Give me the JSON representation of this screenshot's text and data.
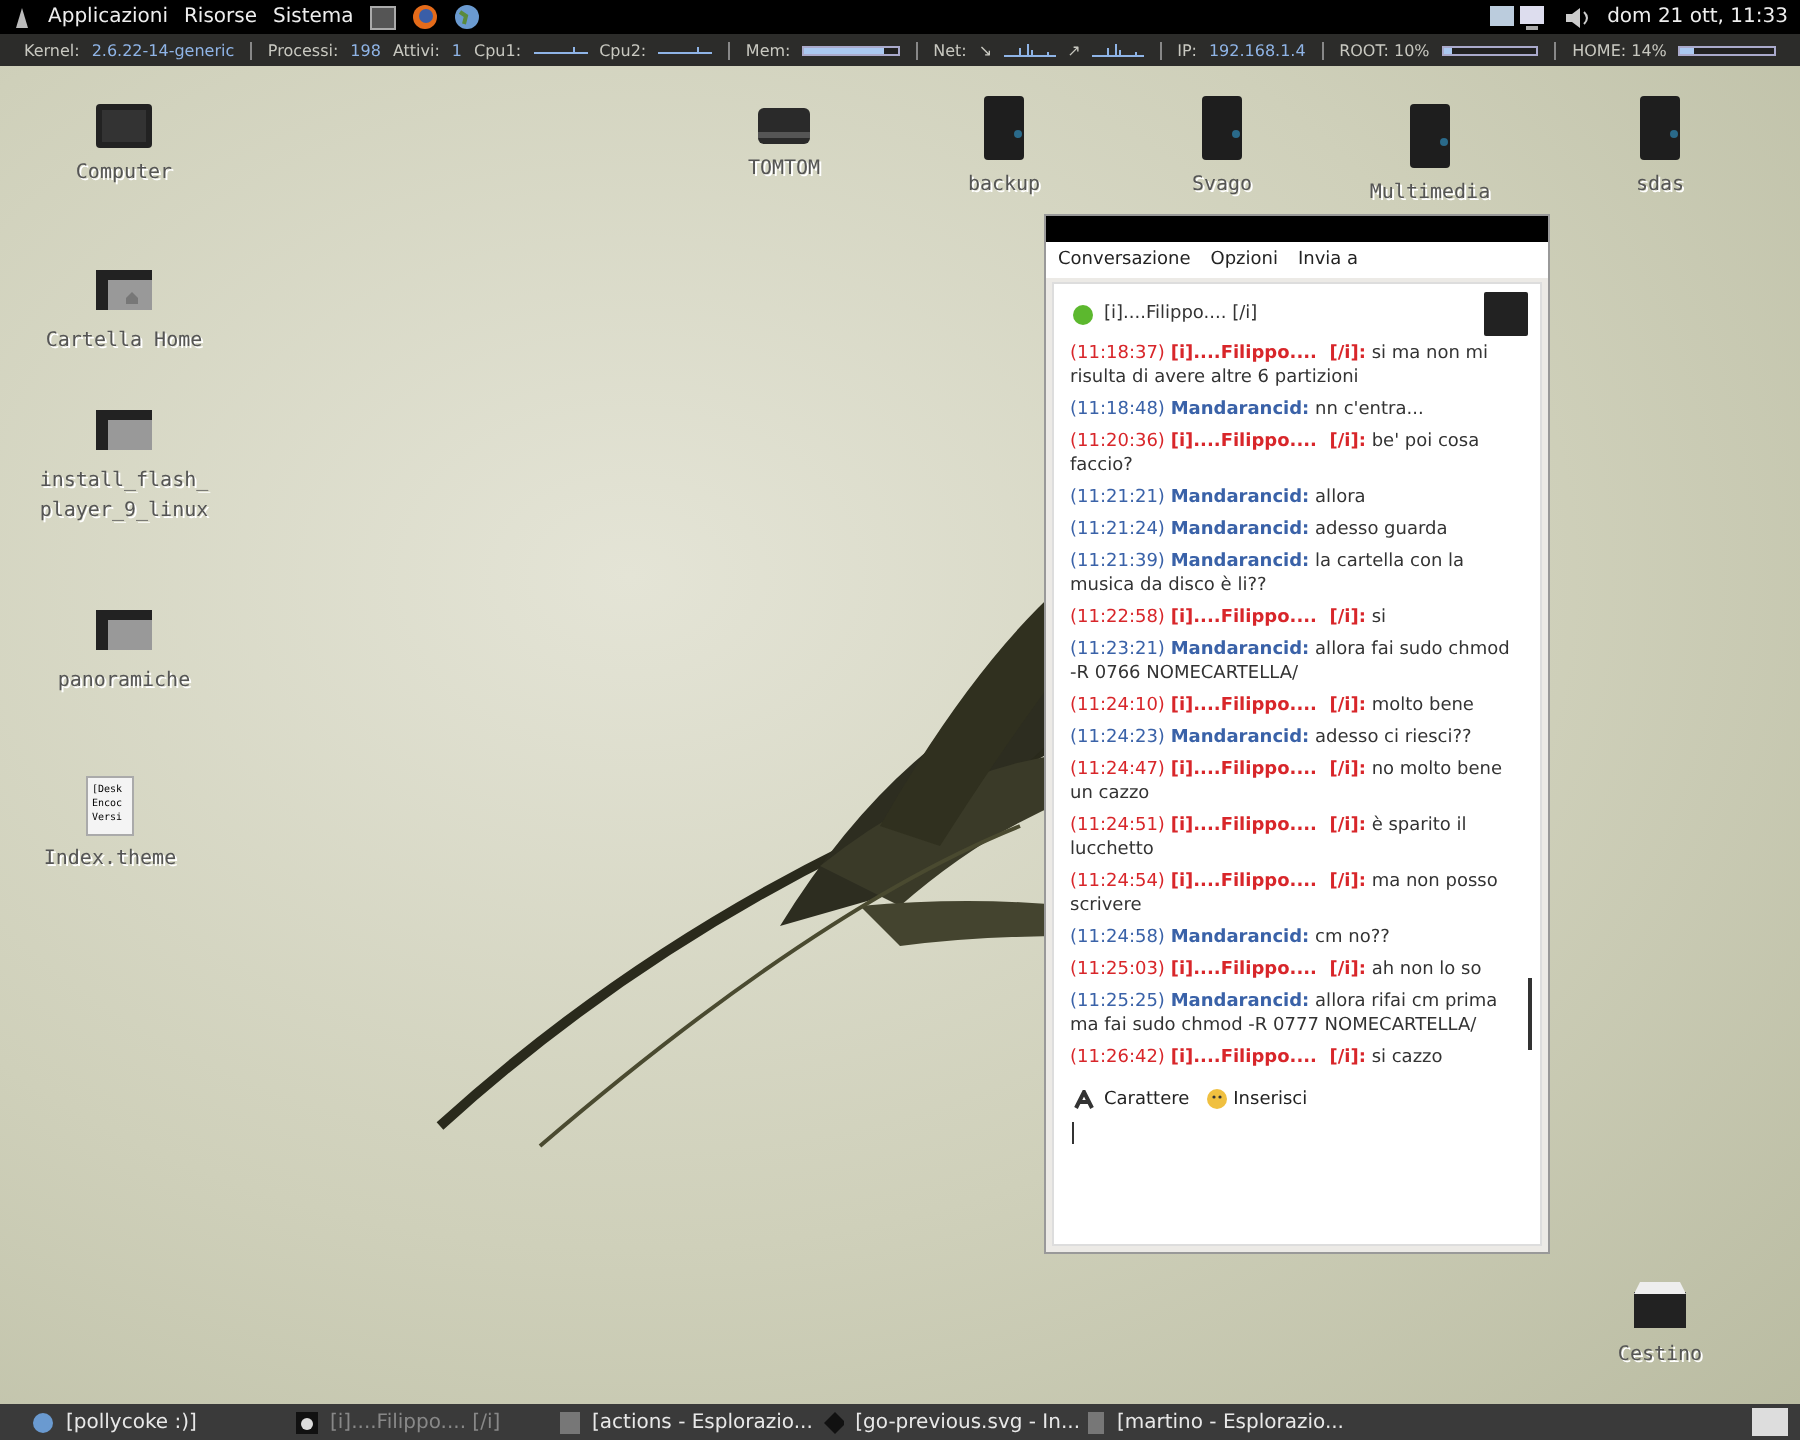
{
  "top_panel": {
    "menus": [
      "Applicazioni",
      "Risorse",
      "Sistema"
    ],
    "clock": "dom 21 ott, 11:33"
  },
  "system_monitor": [
    {
      "kind": "text",
      "label": "Kernel:",
      "value": "2.6.22-14-generic"
    },
    {
      "kind": "text",
      "label": "Processi:",
      "value": "198"
    },
    {
      "kind": "text",
      "label": "Attivi:",
      "value": "1"
    },
    {
      "kind": "graph",
      "label": "Cpu1:"
    },
    {
      "kind": "graph",
      "label": "Cpu2:"
    },
    {
      "kind": "bar",
      "label": "Mem:",
      "level": 0.85
    },
    {
      "kind": "net",
      "label": "Net:",
      "value": "↘"
    },
    {
      "kind": "net",
      "value": "↗"
    },
    {
      "kind": "text",
      "label": "IP:",
      "value": "192.168.1.4"
    },
    {
      "kind": "bar",
      "label": "ROOT: 10%",
      "level": 0.1
    },
    {
      "kind": "bar",
      "label": "HOME: 14%",
      "level": 0.14
    }
  ],
  "desktop_icons": [
    {
      "kind": "computer",
      "label": "Computer"
    },
    {
      "kind": "drive",
      "label": "TOMTOM"
    },
    {
      "kind": "disk",
      "label": "backup"
    },
    {
      "kind": "disk",
      "label": "Svago"
    },
    {
      "kind": "disk",
      "label": "Multimedia"
    },
    {
      "kind": "disk",
      "label": "sdas"
    },
    {
      "kind": "home",
      "label": "Cartella Home"
    },
    {
      "kind": "folder",
      "label": "install_flash_ player_9_linux"
    },
    {
      "kind": "folder",
      "label": "panoramiche"
    },
    {
      "kind": "file",
      "label": "Index.theme",
      "preview": [
        "[Desk",
        "Encoc",
        "Versi"
      ]
    },
    {
      "kind": "trash",
      "label": "Cestino"
    }
  ],
  "chat_window": {
    "menu": [
      "Conversazione",
      "Opzioni",
      "Invia a"
    ],
    "buddy": {
      "name": "[i]....Filippo.... [/i]",
      "online": true
    },
    "messages": [
      {
        "kind": "peer",
        "time": "(11:18:37)",
        "sender": "[i]....Filippo....  [/i]:",
        "text": "si ma non mi risulta di avere altre 6 partizioni"
      },
      {
        "kind": "self",
        "time": "(11:18:48)",
        "sender": "Mandarancid:",
        "text": "nn c'entra..."
      },
      {
        "kind": "peer",
        "time": "(11:20:36)",
        "sender": "[i]....Filippo....  [/i]:",
        "text": "be' poi cosa faccio?"
      },
      {
        "kind": "self",
        "time": "(11:21:21)",
        "sender": "Mandarancid:",
        "text": "allora"
      },
      {
        "kind": "self",
        "time": "(11:21:24)",
        "sender": "Mandarancid:",
        "text": "adesso guarda"
      },
      {
        "kind": "self",
        "time": "(11:21:39)",
        "sender": "Mandarancid:",
        "text": "la cartella con la musica da disco è li??"
      },
      {
        "kind": "peer",
        "time": "(11:22:58)",
        "sender": "[i]....Filippo....  [/i]:",
        "text": "si"
      },
      {
        "kind": "self",
        "time": "(11:23:21)",
        "sender": "Mandarancid:",
        "text": "allora fai sudo chmod -R 0766 NOMECARTELLA/"
      },
      {
        "kind": "peer",
        "time": "(11:24:10)",
        "sender": "[i]....Filippo....  [/i]:",
        "text": "molto bene"
      },
      {
        "kind": "self",
        "time": "(11:24:23)",
        "sender": "Mandarancid:",
        "text": "adesso ci riesci??"
      },
      {
        "kind": "peer",
        "time": "(11:24:47)",
        "sender": "[i]....Filippo....  [/i]:",
        "text": "no molto bene un cazzo"
      },
      {
        "kind": "peer",
        "time": "(11:24:51)",
        "sender": "[i]....Filippo....  [/i]:",
        "text": "è sparito il lucchetto"
      },
      {
        "kind": "peer",
        "time": "(11:24:54)",
        "sender": "[i]....Filippo....  [/i]:",
        "text": "ma non posso scrivere"
      },
      {
        "kind": "self",
        "time": "(11:24:58)",
        "sender": "Mandarancid:",
        "text": "cm no??"
      },
      {
        "kind": "peer",
        "time": "(11:25:03)",
        "sender": "[i]....Filippo....  [/i]:",
        "text": "ah non lo so"
      },
      {
        "kind": "self",
        "time": "(11:25:25)",
        "sender": "Mandarancid:",
        "text": "allora rifai cm prima ma fai  sudo chmod -R 0777 NOMECARTELLA/"
      },
      {
        "kind": "peer",
        "time": "(11:26:42)",
        "sender": "[i]....Filippo....  [/i]:",
        "text": "si cazzo"
      }
    ],
    "toolbar": [
      "Carattere",
      "Inserisci"
    ]
  },
  "taskbar": [
    {
      "kind": "user",
      "label": "[pollycoke :)]",
      "minimized": false
    },
    {
      "kind": "chat",
      "label": "[i]....Filippo.... [/i]",
      "minimized": true
    },
    {
      "kind": "files",
      "label": "[actions - Esplorazio...",
      "minimized": false
    },
    {
      "kind": "image",
      "label": "[go-previous.svg - In...",
      "minimized": false
    },
    {
      "kind": "files",
      "label": "[martino - Esplorazio...",
      "minimized": false
    }
  ]
}
